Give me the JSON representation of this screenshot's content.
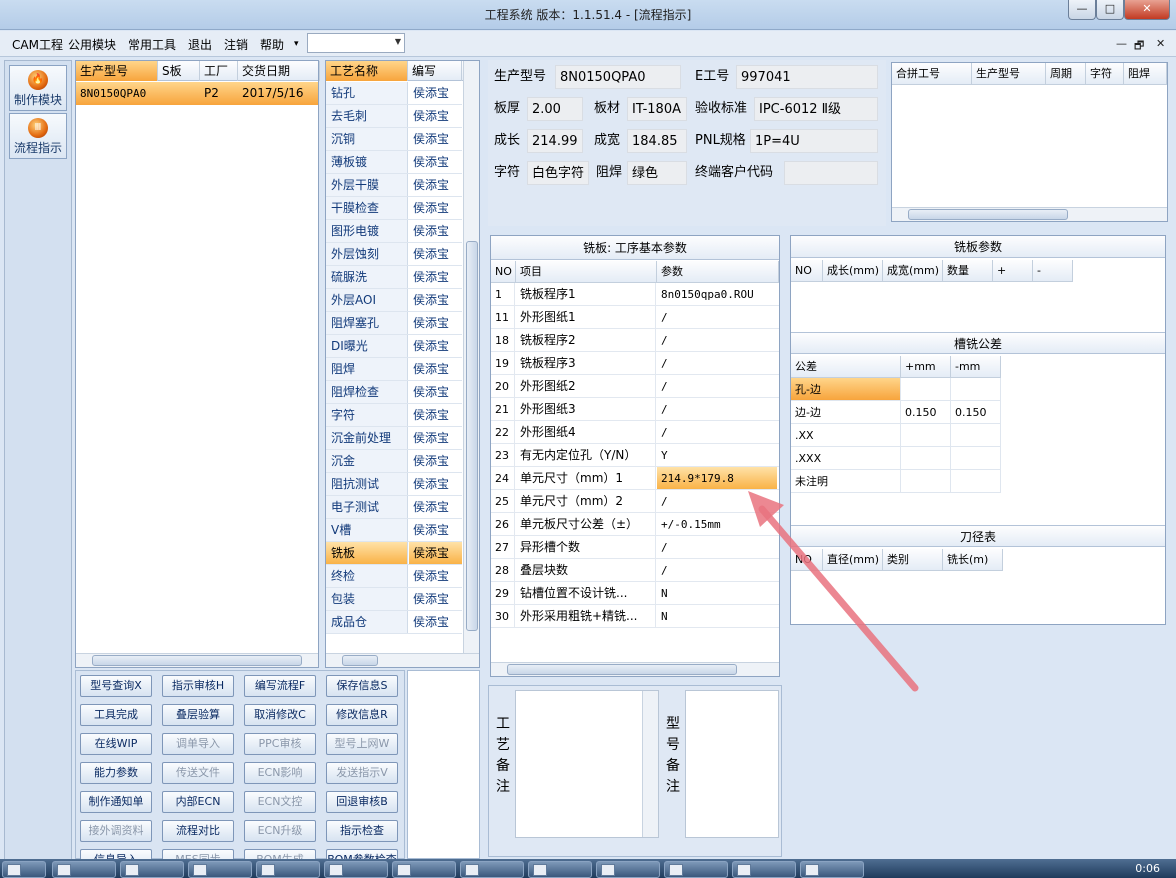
{
  "title": "工程系统   版本：1.1.51.4 - [流程指示]",
  "window_buttons": [
    "—",
    "□",
    "✕"
  ],
  "menu": [
    "CAM工程",
    "公用模块",
    "常用工具",
    "退出",
    "注销",
    "帮助"
  ],
  "menu_overflow": "▾",
  "mdi_buttons": [
    "—",
    "🗗",
    "✕"
  ],
  "left_nav": [
    {
      "label": "制作模块",
      "icon": "flame-icon"
    },
    {
      "label": "流程指示",
      "icon": "process-icon"
    }
  ],
  "orders": {
    "columns": [
      "生产型号",
      "S板",
      "工厂",
      "交货日期"
    ],
    "rows": [
      [
        "8N0150QPA0",
        "",
        "P2",
        "2017/5/16"
      ]
    ]
  },
  "process": {
    "columns": [
      "工艺名称",
      "编写"
    ],
    "rows": [
      [
        "钻孔",
        "侯添宝"
      ],
      [
        "去毛刺",
        "侯添宝"
      ],
      [
        "沉铜",
        "侯添宝"
      ],
      [
        "薄板镀",
        "侯添宝"
      ],
      [
        "外层干膜",
        "侯添宝"
      ],
      [
        "干膜检查",
        "侯添宝"
      ],
      [
        "图形电镀",
        "侯添宝"
      ],
      [
        "外层蚀刻",
        "侯添宝"
      ],
      [
        "硫脲洗",
        "侯添宝"
      ],
      [
        "外层AOI",
        "侯添宝"
      ],
      [
        "阻焊塞孔",
        "侯添宝"
      ],
      [
        "DI曝光",
        "侯添宝"
      ],
      [
        "阻焊",
        "侯添宝"
      ],
      [
        "阻焊检查",
        "侯添宝"
      ],
      [
        "字符",
        "侯添宝"
      ],
      [
        "沉金前处理",
        "侯添宝"
      ],
      [
        "沉金",
        "侯添宝"
      ],
      [
        "阻抗测试",
        "侯添宝"
      ],
      [
        "电子测试",
        "侯添宝"
      ],
      [
        "V槽",
        "侯添宝"
      ],
      [
        "铣板",
        "侯添宝"
      ],
      [
        "终检",
        "侯添宝"
      ],
      [
        "包装",
        "侯添宝"
      ],
      [
        "成品仓",
        "侯添宝"
      ]
    ],
    "selected": 20
  },
  "buttons": [
    [
      "型号查询X",
      "指示审核H",
      "编写流程F",
      "保存信息S"
    ],
    [
      "工具完成",
      "叠层验算",
      "取消修改C",
      "修改信息R"
    ],
    [
      "在线WIP",
      "调单导入",
      "PPC审核",
      "型号上网W"
    ],
    [
      "能力参数",
      "传送文件",
      "ECN影响",
      "发送指示V"
    ],
    [
      "制作通知单",
      "内部ECN",
      "ECN文控",
      "回退审核B"
    ],
    [
      "接外调资料",
      "流程对比",
      "ECN升级",
      "指示检查"
    ],
    [
      "信息导入",
      "MES同步",
      "BOM生成",
      "BOM参数检查"
    ]
  ],
  "disabled_buttons": [
    "调单导入",
    "PPC审核",
    "型号上网W",
    "传送文件",
    "ECN影响",
    "发送指示V",
    "ECN文控",
    "接外调资料",
    "ECN升级",
    "MES同步",
    "BOM生成"
  ],
  "info": {
    "model_label": "生产型号",
    "model": "8N0150QPA0",
    "eno_label": "E工号",
    "eno": "997041",
    "thick_label": "板厚",
    "thick": "2.00",
    "mat_label": "板材",
    "mat": "IT-180A",
    "std_label": "验收标准",
    "std": "IPC-6012 Ⅱ级",
    "len_label": "成长",
    "len": "214.99",
    "wid_label": "成宽",
    "wid": "184.85",
    "pnl_label": "PNL规格",
    "pnl": "1P=4U",
    "char_label": "字符",
    "char": "白色字符",
    "mask_label": "阻焊",
    "mask": "绿色",
    "cust_label": "终端客户代码",
    "cust": ""
  },
  "combine": {
    "columns": [
      "合拼工号",
      "生产型号",
      "周期",
      "字符",
      "阻焊"
    ]
  },
  "params": {
    "title": "铣板: 工序基本参数",
    "columns": [
      "NO",
      "项目",
      "参数"
    ],
    "rows": [
      [
        "1",
        "铣板程序1",
        "8n0150qpa0.ROU"
      ],
      [
        "11",
        "外形图纸1",
        "/"
      ],
      [
        "18",
        "铣板程序2",
        "/"
      ],
      [
        "19",
        "铣板程序3",
        "/"
      ],
      [
        "20",
        "外形图纸2",
        "/"
      ],
      [
        "21",
        "外形图纸3",
        "/"
      ],
      [
        "22",
        "外形图纸4",
        "/"
      ],
      [
        "23",
        "有无内定位孔（Y/N）",
        "Y"
      ],
      [
        "24",
        "单元尺寸（mm）1",
        "214.9*179.8"
      ],
      [
        "25",
        "单元尺寸（mm）2",
        "/"
      ],
      [
        "26",
        "单元板尺寸公差（±）",
        "+/-0.15mm"
      ],
      [
        "27",
        "异形槽个数",
        "/"
      ],
      [
        "28",
        "叠层块数",
        "/"
      ],
      [
        "29",
        "钻槽位置不设计铣...",
        "N"
      ],
      [
        "30",
        "外形采用粗铣+精铣...",
        "N"
      ]
    ],
    "selected": 8
  },
  "mill_params": {
    "title": "铣板参数",
    "columns": [
      "NO",
      "成长(mm)",
      "成宽(mm)",
      "数量",
      "+",
      "-"
    ]
  },
  "slot_tol": {
    "title": "槽铣公差",
    "columns": [
      "公差",
      "+mm",
      "-mm"
    ],
    "rows": [
      [
        "孔-边",
        "",
        ""
      ],
      [
        "边-边",
        "0.150",
        "0.150"
      ],
      [
        ".XX",
        "",
        ""
      ],
      [
        ".XXX",
        "",
        ""
      ],
      [
        "未注明",
        "",
        ""
      ]
    ]
  },
  "tool_table": {
    "title": "刀径表",
    "columns": [
      "NO",
      "直径(mm)",
      "类别",
      "铣长(m)"
    ]
  },
  "remarks": {
    "process_label": [
      "工",
      "艺",
      "备",
      "注"
    ],
    "model_label": [
      "型",
      "号",
      "备",
      "注"
    ]
  },
  "clock": "0:06",
  "colors": {
    "accent": "#f7a43c",
    "arrow": "#e9737f"
  }
}
